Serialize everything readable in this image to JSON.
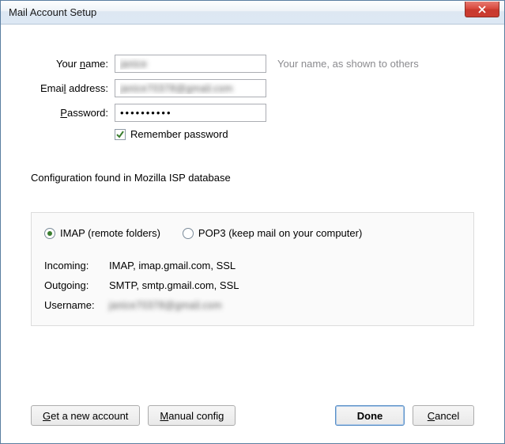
{
  "window": {
    "title": "Mail Account Setup"
  },
  "form": {
    "name_label_pre": "Your ",
    "name_label_u": "n",
    "name_label_post": "ame:",
    "name_value": "janice",
    "name_hint": "Your name, as shown to others",
    "email_label_pre": "Emai",
    "email_label_u": "l",
    "email_label_post": " address:",
    "email_value": "janice70378@gmail.com",
    "password_label_pre": "",
    "password_label_u": "P",
    "password_label_post": "assword:",
    "password_value": "••••••••••",
    "remember_checked": true,
    "remember_pre": "Re",
    "remember_u": "m",
    "remember_post": "ember password"
  },
  "status": "Configuration found in Mozilla ISP database",
  "protocols": {
    "imap_selected": true,
    "imap_label": "IMAP (remote folders)",
    "pop3_selected": false,
    "pop3_label": "POP3 (keep mail on your computer)"
  },
  "details": {
    "incoming_label": "Incoming:",
    "incoming_value": "IMAP, imap.gmail.com, SSL",
    "outgoing_label": "Outgoing:",
    "outgoing_value": "SMTP, smtp.gmail.com, SSL",
    "username_label": "Username:",
    "username_value": "janice70378@gmail.com"
  },
  "buttons": {
    "new_account_u": "G",
    "new_account_post": "et a new account",
    "manual_u": "M",
    "manual_post": "anual config",
    "done": "Done",
    "cancel_u": "C",
    "cancel_post": "ancel"
  }
}
